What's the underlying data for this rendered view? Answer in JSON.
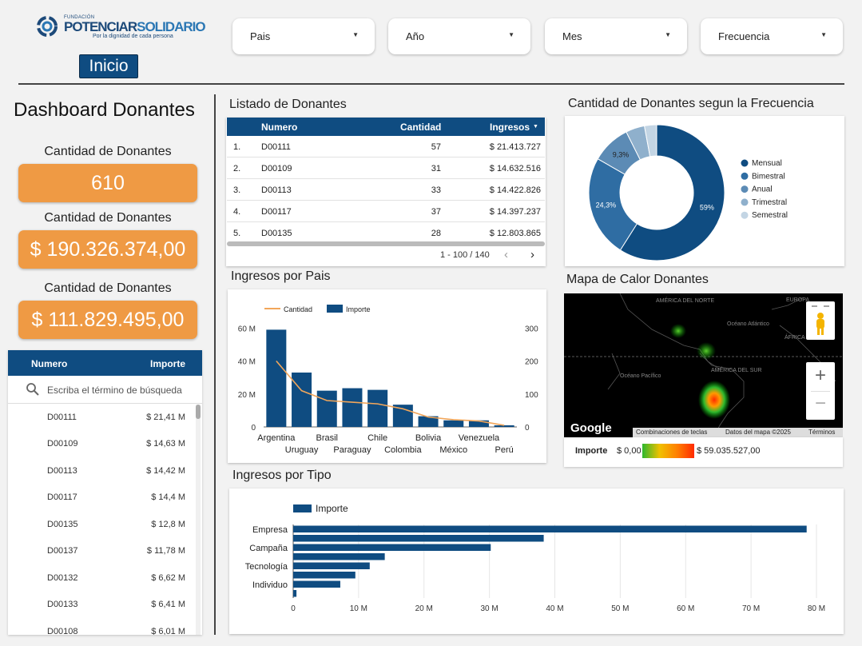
{
  "header": {
    "logo_small": "FUNDACIÓN",
    "logo_name_a": "POTENCIAR",
    "logo_name_b": "SOLIDARIO",
    "logo_tagline": "Por la dignidad de cada persona",
    "home_button": "Inicio",
    "filters": [
      "Pais",
      "Año",
      "Mes",
      "Frecuencia"
    ]
  },
  "left": {
    "title": "Dashboard Donantes",
    "kpis": [
      {
        "label": "Cantidad de Donantes",
        "value": "610"
      },
      {
        "label": "Cantidad de Donantes",
        "value": "$ 190.326.374,00"
      },
      {
        "label": "Cantidad de Donantes",
        "value": "$ 111.829.495,00"
      }
    ],
    "table": {
      "col_numero": "Numero",
      "col_importe": "Importe",
      "search_placeholder": "Escriba el término de búsqueda",
      "rows": [
        {
          "numero": "D00111",
          "importe": "$ 21,41 M"
        },
        {
          "numero": "D00109",
          "importe": "$ 14,63 M"
        },
        {
          "numero": "D00113",
          "importe": "$ 14,42 M"
        },
        {
          "numero": "D00117",
          "importe": "$ 14,4 M"
        },
        {
          "numero": "D00135",
          "importe": "$ 12,8 M"
        },
        {
          "numero": "D00137",
          "importe": "$ 11,78 M"
        },
        {
          "numero": "D00132",
          "importe": "$ 6,62 M"
        },
        {
          "numero": "D00133",
          "importe": "$ 6,41 M"
        },
        {
          "numero": "D00108",
          "importe": "$ 6,01 M"
        }
      ]
    }
  },
  "donor_list": {
    "title": "Listado de Donantes",
    "col_numero": "Numero",
    "col_cantidad": "Cantidad",
    "col_ingresos": "Ingresos",
    "rows": [
      {
        "idx": "1.",
        "numero": "D00111",
        "cantidad": "57",
        "ingresos": "$ 21.413.727"
      },
      {
        "idx": "2.",
        "numero": "D00109",
        "cantidad": "31",
        "ingresos": "$ 14.632.516"
      },
      {
        "idx": "3.",
        "numero": "D00113",
        "cantidad": "33",
        "ingresos": "$ 14.422.826"
      },
      {
        "idx": "4.",
        "numero": "D00117",
        "cantidad": "37",
        "ingresos": "$ 14.397.237"
      },
      {
        "idx": "5.",
        "numero": "D00135",
        "cantidad": "28",
        "ingresos": "$ 12.803.865"
      }
    ],
    "pager": "1 - 100 / 140"
  },
  "donut_title": "Cantidad de Donantes segun la Frecuencia",
  "pais_title": "Ingresos por Pais",
  "map": {
    "title": "Mapa de Calor Donantes",
    "labels": [
      "AMÉRICA DEL NORTE",
      "EUROPA",
      "Océano Atlántico",
      "ÁFRICA",
      "Océano Pacífico",
      "AMÉRICA DEL SUR"
    ],
    "google": "Google",
    "attr": [
      "Combinaciones de teclas",
      "Datos del mapa ©2025",
      "Términos"
    ],
    "legend_label": "Importe",
    "legend_min": "$ 0,00",
    "legend_max": "$ 59.035.527,00"
  },
  "tipo_title": "Ingresos por Tipo",
  "chart_data": [
    {
      "type": "pie",
      "title": "Cantidad de Donantes segun la Frecuencia",
      "categories": [
        "Mensual",
        "Bimestral",
        "Anual",
        "Trimestral",
        "Semestral"
      ],
      "values": [
        59,
        24.3,
        9.3,
        4.5,
        2.9
      ],
      "data_labels": [
        "59%",
        "24,3%",
        "9,3%"
      ],
      "colors": [
        "#0f4c81",
        "#2f6da3",
        "#5c8bb5",
        "#8fb0cc",
        "#c3d5e4"
      ],
      "legend": "right"
    },
    {
      "type": "bar",
      "title": "Ingresos por Pais",
      "categories": [
        "Argentina",
        "Uruguay",
        "Brasil",
        "Paraguay",
        "Chile",
        "Colombia",
        "Bolivia",
        "México",
        "Venezuela",
        "Perú"
      ],
      "series": [
        {
          "name": "Importe",
          "type": "bar",
          "axis": "left",
          "values": [
            59,
            33,
            22,
            23.5,
            22.5,
            13.5,
            6.5,
            4,
            4,
            1
          ]
        },
        {
          "name": "Cantidad",
          "type": "line",
          "axis": "right",
          "values": [
            200,
            110,
            80,
            75,
            70,
            55,
            30,
            22,
            18,
            5
          ]
        }
      ],
      "y_left_ticks": [
        "0",
        "20 M",
        "40 M",
        "60 M"
      ],
      "y_left_lim": [
        0,
        65
      ],
      "y_right_ticks": [
        "0",
        "100",
        "200",
        "300"
      ],
      "y_right_lim": [
        0,
        325
      ],
      "colors": {
        "bar": "#0f4c81",
        "line": "#f2a65a"
      },
      "legend": "top-left"
    },
    {
      "type": "bar",
      "orientation": "horizontal",
      "title": "Ingresos por Tipo",
      "categories": [
        "Empresa",
        "",
        "Campaña",
        "",
        "Tecnología",
        "",
        "Individuo",
        ""
      ],
      "series": [
        {
          "name": "Importe",
          "values": [
            78.5,
            38.3,
            30.2,
            14,
            11.7,
            9.5,
            7.2,
            0.5
          ]
        }
      ],
      "x_ticks": [
        "0",
        "10 M",
        "20 M",
        "30 M",
        "40 M",
        "50 M",
        "60 M",
        "70 M",
        "80 M"
      ],
      "xlim": [
        0,
        80
      ],
      "colors": {
        "bar": "#0f4c81"
      },
      "legend": "top-left"
    }
  ]
}
